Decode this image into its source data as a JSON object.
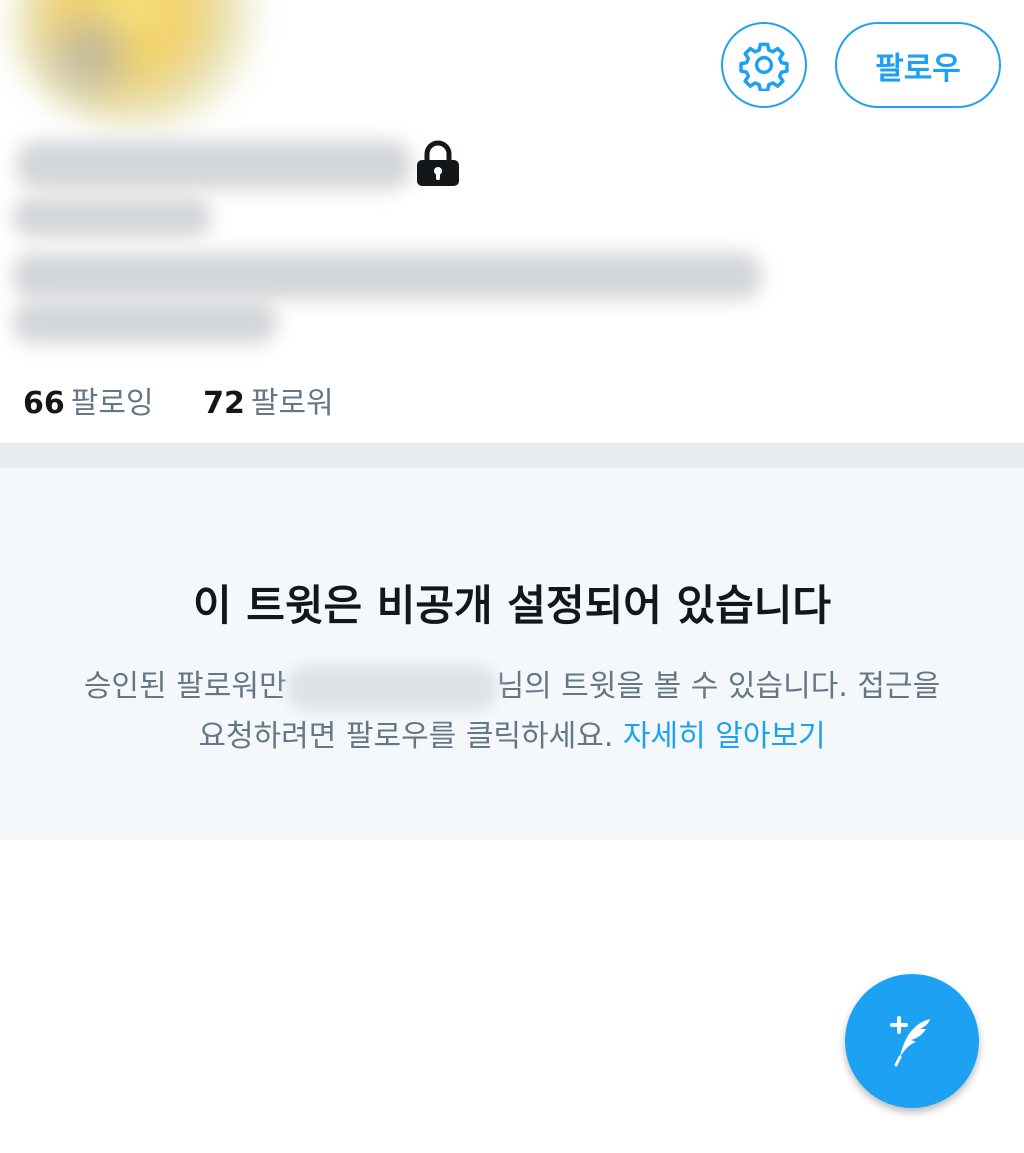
{
  "profile": {
    "follow_label": "팔로우",
    "stats": [
      {
        "count": "66",
        "label": "팔로잉"
      },
      {
        "count": "72",
        "label": "팔로워"
      }
    ]
  },
  "private_notice": {
    "title": "이 트윗은 비공개 설정되어 있습니다",
    "desc_before": "승인된 팔로워만",
    "desc_after": "님의 트윗을 볼 수 있습니다. 접근을",
    "desc_line2": "요청하려면 팔로우를 클릭하세요.",
    "learn_more": "자세히 알아보기"
  },
  "icons": {
    "settings": "gear-icon",
    "protected": "lock-icon",
    "compose": "compose-tweet-icon"
  },
  "colors": {
    "accent": "#1da1f2",
    "text_primary": "#14171a",
    "text_secondary": "#657786",
    "panel_bg": "#f5f8fa",
    "divider": "#e6ecf0"
  }
}
